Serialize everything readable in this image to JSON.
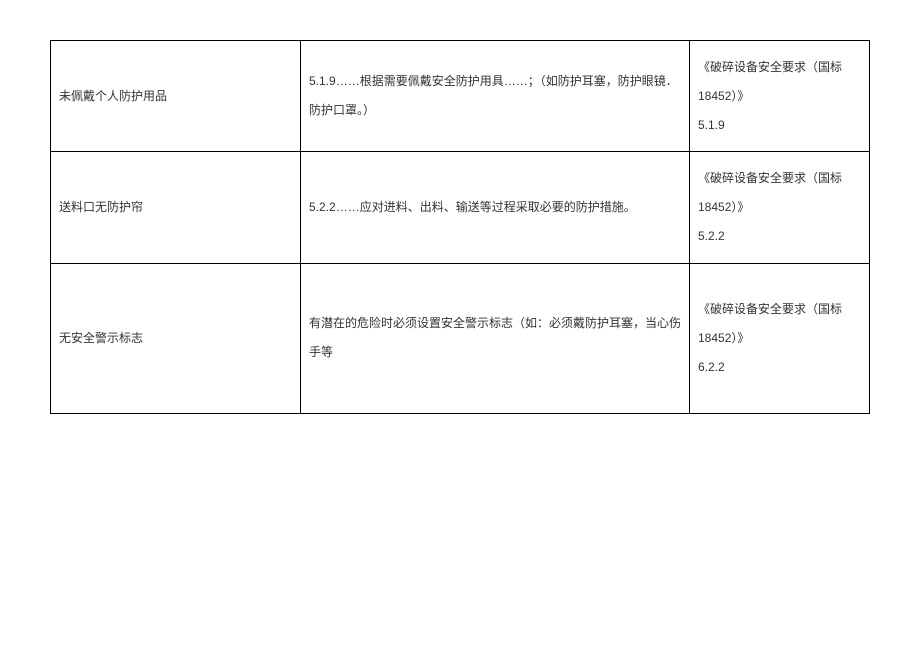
{
  "rows": [
    {
      "issue": "未佩戴个人防护用品",
      "requirement": "5.1.9……根据需要佩戴安全防护用具……；（如防护耳塞，防护眼镜．防护口罩。）",
      "reference_title": "《破碎设备安全要求（国标18452）》",
      "reference_clause": "5.1.9"
    },
    {
      "issue": "送料口无防护帘",
      "requirement": "5.2.2……应对进料、出料、输送等过程采取必要的防护措施。",
      "reference_title": "《破碎设备安全要求（国标18452）》",
      "reference_clause": "5.2.2"
    },
    {
      "issue": "无安全警示标志",
      "requirement": "有潜在的危险时必须设置安全警示标志（如：必须戴防护耳塞，当心伤手等",
      "reference_title": "《破碎设备安全要求（国标18452）》",
      "reference_clause": "6.2.2"
    }
  ]
}
